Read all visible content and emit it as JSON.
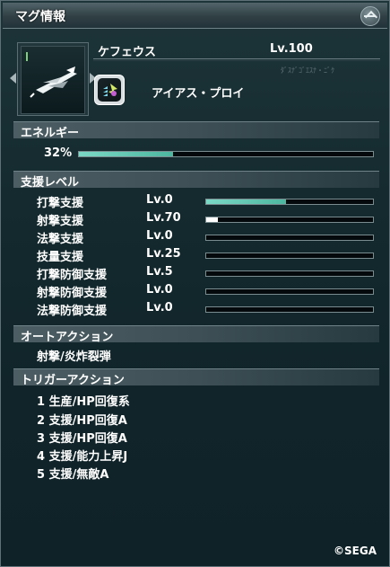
{
  "window": {
    "title": "マグ情報"
  },
  "mag": {
    "name": "ケフェウス",
    "level": "Lv.100",
    "photon_blast": "アイアス・プロイ",
    "glyph_text": "ﾀﾞｽﾅﾞｺﾞｴｽﾅ・ﾆﾞｸ"
  },
  "energy": {
    "label": "エネルギー",
    "percent_text": "32%",
    "percent": 0.32
  },
  "support": {
    "label": "支援レベル",
    "rows": [
      {
        "name": "打撃支援",
        "level": "Lv.0",
        "fill": 0.48
      },
      {
        "name": "射撃支援",
        "level": "Lv.70",
        "fill": 0.07
      },
      {
        "name": "法撃支援",
        "level": "Lv.0",
        "fill": 0.0
      },
      {
        "name": "技量支援",
        "level": "Lv.25",
        "fill": 0.0
      },
      {
        "name": "打撃防御支援",
        "level": "Lv.5",
        "fill": 0.0
      },
      {
        "name": "射撃防御支援",
        "level": "Lv.0",
        "fill": 0.0
      },
      {
        "name": "法撃防御支援",
        "level": "Lv.0",
        "fill": 0.0
      }
    ]
  },
  "auto_action": {
    "label": "オートアクション",
    "items": [
      "射撃/炎炸裂弾"
    ]
  },
  "trigger_action": {
    "label": "トリガーアクション",
    "items": [
      "1 生産/HP回復系",
      "2 支援/HP回復A",
      "3 支援/HP回復A",
      "4 支援/能力上昇J",
      "5 支援/無敵A"
    ]
  },
  "copyright": "©SEGA",
  "colors": {
    "bar_fill": "#5fc9b1",
    "bar_fill_white": "#ffffff",
    "panel_bg": "#142a2e"
  },
  "icons": {
    "close": "close-icon",
    "mag_sprite": "mag-icon",
    "photon_blast": "photon-blast-icon"
  }
}
